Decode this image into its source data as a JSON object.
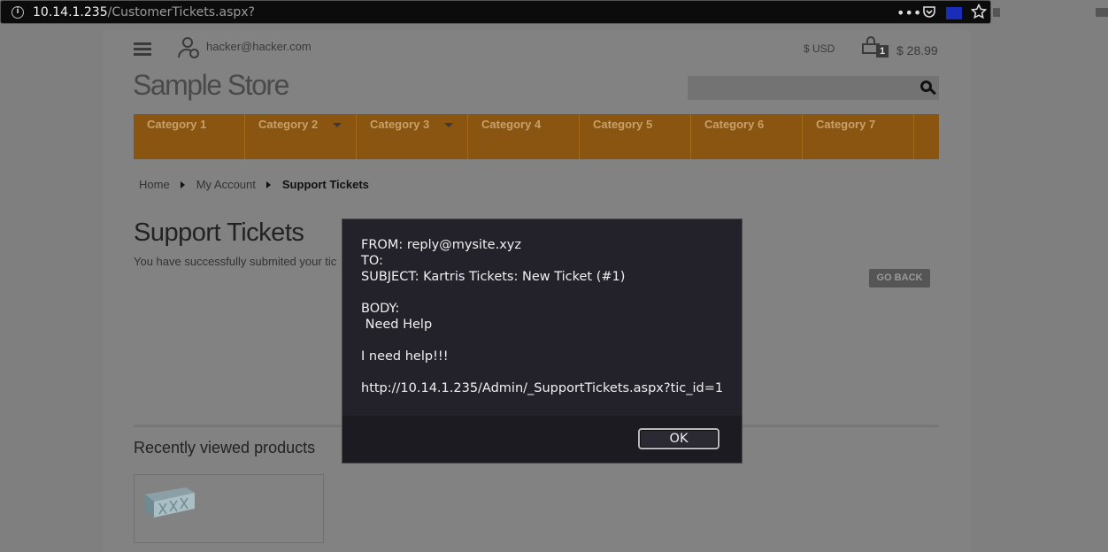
{
  "browser": {
    "url_host": "10.14.1.235",
    "url_path": "/CustomerTickets.aspx?",
    "info_icon": "i",
    "icons": [
      "more-icon",
      "pocket-icon",
      "extension-icon",
      "bookmark-star-icon"
    ]
  },
  "header": {
    "user_email": "hacker@hacker.com",
    "currency": "$ USD",
    "cart_count": "1",
    "cart_total": "$ 28.99",
    "store_title": "Sample Store",
    "search_placeholder": ""
  },
  "categories": [
    {
      "label": "Category 1",
      "has_dropdown": false
    },
    {
      "label": "Category 2",
      "has_dropdown": true
    },
    {
      "label": "Category 3",
      "has_dropdown": true
    },
    {
      "label": "Category 4",
      "has_dropdown": false
    },
    {
      "label": "Category 5",
      "has_dropdown": false
    },
    {
      "label": "Category 6",
      "has_dropdown": false
    },
    {
      "label": "Category 7",
      "has_dropdown": false
    }
  ],
  "breadcrumb": [
    "Home",
    "My Account",
    "Support Tickets"
  ],
  "main": {
    "title": "Support Tickets",
    "success_message": "You have successfully submited your tic",
    "go_back_label": "GO BACK",
    "recent_title": "Recently viewed products"
  },
  "dialog": {
    "lines": [
      "FROM: reply@mysite.xyz",
      "TO:",
      "SUBJECT: Kartris Tickets: New Ticket (#1)",
      "",
      "BODY:",
      " Need Help",
      "",
      "I need help!!!",
      "",
      "http://10.14.1.235/Admin/_SupportTickets.aspx?tic_id=1"
    ],
    "ok_label": "OK"
  },
  "colors": {
    "overlay_bg": "#7f7f7f",
    "category_bar": "#8a5510",
    "dialog_bg": "#23222b"
  }
}
